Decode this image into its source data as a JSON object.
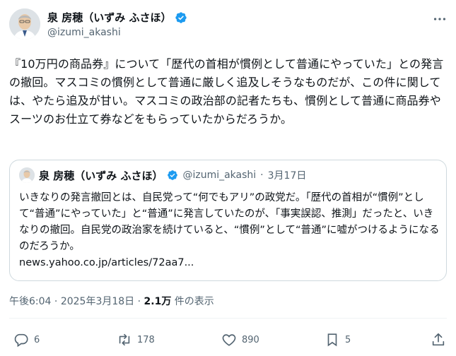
{
  "author": {
    "display_name": "泉 房穂（いずみ ふさほ）",
    "handle": "@izumi_akashi",
    "avatar_icon": "avatar-portrait",
    "verified_icon": "verified-badge-icon",
    "verified_color": "#1d9bf0"
  },
  "tweet": {
    "text": "『10万円の商品券』について「歴代の首相が慣例として普通にやっていた」との発言の撤回。マスコミの慣例として普通に厳しく追及しそうなものだが、この件に関しては、やたら追及が甘い。マスコミの政治部の記者たちも、慣例として普通に商品券やスーツのお仕立て券などをもらっていたからだろうか。",
    "time": "午後6:04",
    "separator": "·",
    "date": "2025年3月18日",
    "views_count": "2.1万",
    "views_label": "件の表示"
  },
  "quote": {
    "display_name": "泉 房穂（いずみ ふさほ）",
    "handle": "@izumi_akashi",
    "separator": "·",
    "date": "3月17日",
    "text": "いきなりの発言撤回とは、自民党って“何でもアリ”の政党だ。「歴代の首相が“慣例”として“普通”にやっていた」と“普通”に発言していたのが、「事実誤認、推測」だったと、いきなりの撤回。自民党の政治家を続けていると、“慣例”として“普通”に嘘がつけるようになるのだろうか。",
    "link": "news.yahoo.co.jp/articles/72aa7..."
  },
  "actions": {
    "reply_count": "6",
    "retweet_count": "178",
    "like_count": "890",
    "bookmark_count": "5"
  },
  "colors": {
    "text_primary": "#0f1419",
    "text_secondary": "#536471",
    "border": "#cfd9de"
  }
}
